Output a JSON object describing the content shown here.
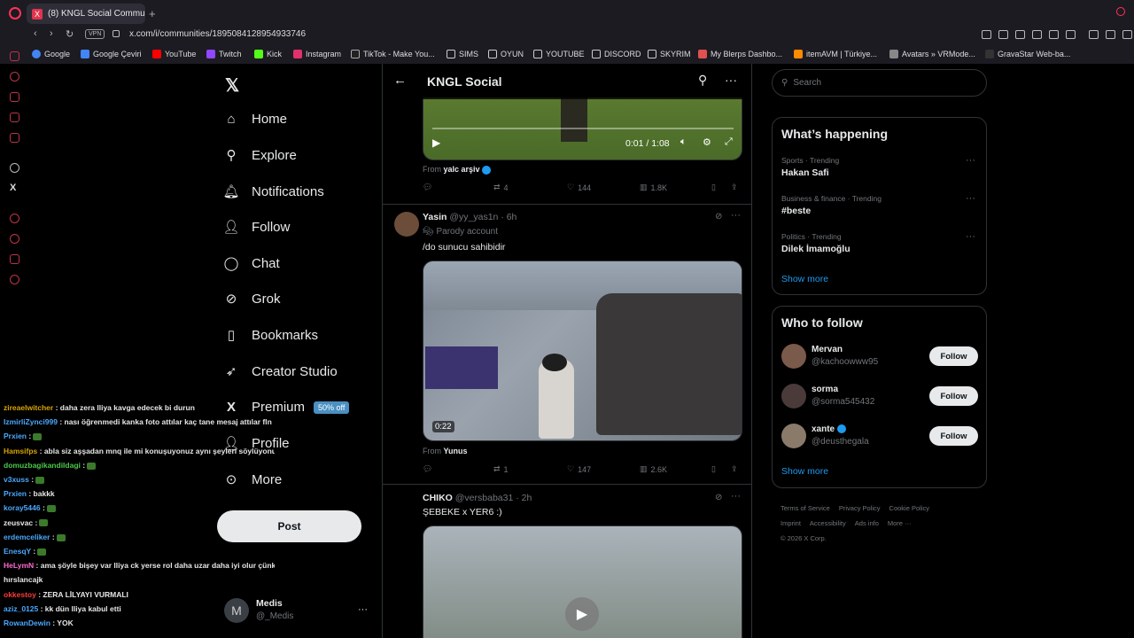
{
  "browser": {
    "tab_title": "(8) KNGL Social Communi",
    "url": "x.com/i/communities/1895084128954933746",
    "vpn": "VPN",
    "bookmarks": [
      "Google",
      "Google Çeviri",
      "YouTube",
      "Twitch",
      "Kick",
      "Instagram",
      "TikTok - Make You...",
      "SIMS",
      "OYUN",
      "YOUTUBE",
      "DISCORD",
      "SKYRIM",
      "My Blerps Dashbo...",
      "itemAVM | Türkiye...",
      "Avatars » VRMode...",
      "GravaStar Web-ba..."
    ]
  },
  "nav": {
    "items": [
      "Home",
      "Explore",
      "Notifications",
      "Follow",
      "Chat",
      "Grok",
      "Bookmarks",
      "Creator Studio",
      "Premium",
      "Profile",
      "More"
    ],
    "premium_badge": "50% off",
    "post_label": "Post",
    "account_name": "Medis",
    "account_handle": "@_Medis",
    "account_initial": "M"
  },
  "chat": [
    {
      "name": "zireaelwitcher",
      "color": "#d9a400",
      "text": ": daha zera lliya kavga edecek bi durun"
    },
    {
      "name": "IzmirliZynci999",
      "color": "#4aa8ff",
      "text": ": nası öğrenmedi kanka foto attılar kaç tane mesaj attılar fln"
    },
    {
      "name": "Prxien",
      "color": "#4aa8ff",
      "text": ":"
    },
    {
      "name": "Hamsifps",
      "color": "#d9a400",
      "text": ": abla siz aşşadan mnq ile mi konuşuyonuz aynı şeyleri söylüyonuz"
    },
    {
      "name": "domuzbagikandildagi",
      "color": "#4cc94c",
      "text": ":"
    },
    {
      "name": "v3xuss",
      "color": "#4aa8ff",
      "text": ":"
    },
    {
      "name": "Prxien",
      "color": "#4aa8ff",
      "text": ": bakkk"
    },
    {
      "name": "koray5446",
      "color": "#4aa8ff",
      "text": ":"
    },
    {
      "name": "zeusvac",
      "color": "#e6e6e6",
      "text": ":"
    },
    {
      "name": "erdemceliker",
      "color": "#4aa8ff",
      "text": ":"
    },
    {
      "name": "EnesqY",
      "color": "#4aa8ff",
      "text": ":"
    },
    {
      "name": "HeLymN",
      "color": "#ff6ad5",
      "text": ": ama şöyle bişey var lliya ck yerse rol daha uzar daha iyi olur çünkü boran"
    },
    {
      "name": "",
      "color": "#e6e6e6",
      "text": "hırslancajk"
    },
    {
      "name": "okkestoy",
      "color": "#ff3b3b",
      "text": ": ZERA LİLYAYI VURMALI"
    },
    {
      "name": "aziz_0125",
      "color": "#4aa8ff",
      "text": ": kk dün lliya kabul etti"
    },
    {
      "name": "RowanDewin",
      "color": "#4aa8ff",
      "text": ": YOK"
    }
  ],
  "main": {
    "community_title": "KNGL Social",
    "post1": {
      "video_time": "0:01 / 1:08",
      "from_label": "From",
      "from_name": "yalc arşiv",
      "replies": "",
      "reposts": "4",
      "likes": "144",
      "views": "1.8K"
    },
    "post2": {
      "name": "Yasin",
      "handle": "@yy_yas1n · 6h",
      "parody": "Parody account",
      "text": "/do sunucu sahibidir",
      "video_time": "0:22",
      "from_label": "From",
      "from_name": "Yunus",
      "reposts": "1",
      "likes": "147",
      "views": "2.6K"
    },
    "post3": {
      "name": "CHIKO",
      "handle": "@versbaba31 · 2h",
      "text": "ŞEBEKE x YER6 :)"
    }
  },
  "right": {
    "search_placeholder": "Search",
    "whats_happening": "What’s happening",
    "trends": [
      {
        "category": "Sports · Trending",
        "name": "Hakan Safi"
      },
      {
        "category": "Business & finance · Trending",
        "name": "#beste"
      },
      {
        "category": "Politics · Trending",
        "name": "Dilek İmamoğlu"
      }
    ],
    "show_more": "Show more",
    "who_to_follow": "Who to follow",
    "suggestions": [
      {
        "name": "Mervan",
        "handle": "@kachoowww95",
        "follow": "Follow"
      },
      {
        "name": "sorma",
        "handle": "@sorma545432",
        "follow": "Follow"
      },
      {
        "name": "xante",
        "handle": "@deusthegala",
        "follow": "Follow"
      }
    ],
    "footer": [
      "Terms of Service",
      "Privacy Policy",
      "Cookie Policy",
      "Imprint",
      "Accessibility",
      "Ads info",
      "More ···",
      "© 2026 X Corp."
    ]
  },
  "colors": {
    "accent": "#1d9bf0",
    "opera_red": "#ff3355"
  }
}
